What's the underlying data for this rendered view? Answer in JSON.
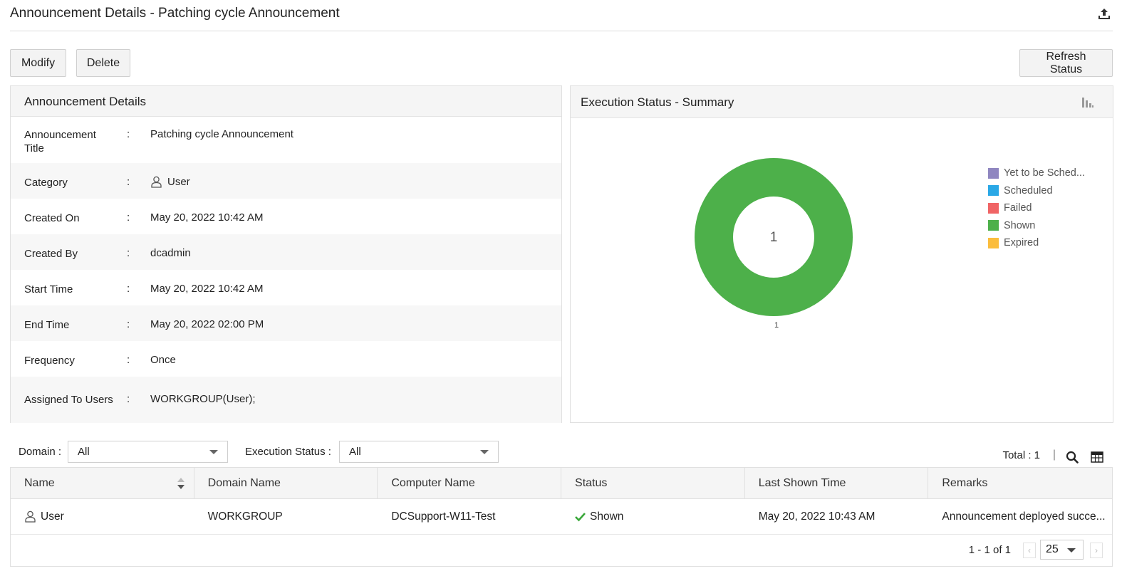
{
  "page": {
    "title": "Announcement Details - Patching cycle Announcement",
    "export_icon": "upload-export-icon"
  },
  "toolbar": {
    "modify_label": "Modify",
    "delete_label": "Delete",
    "refresh_label": "Refresh Status"
  },
  "details": {
    "header": "Announcement Details",
    "separator": ":",
    "rows": [
      {
        "label": "Announcement Title",
        "value": "Patching cycle Announcement"
      },
      {
        "label": "Category",
        "value": "User",
        "icon": "user-icon"
      },
      {
        "label": "Created On",
        "value": "May 20, 2022 10:42 AM"
      },
      {
        "label": "Created By",
        "value": "dcadmin"
      },
      {
        "label": "Start Time",
        "value": "May 20, 2022 10:42 AM"
      },
      {
        "label": "End Time",
        "value": "May 20, 2022 02:00 PM"
      },
      {
        "label": "Frequency",
        "value": "Once"
      },
      {
        "label": "Assigned To Users",
        "value": "WORKGROUP(User);"
      }
    ]
  },
  "summary": {
    "header": "Execution Status - Summary",
    "chart_toggle_icon": "bar-chart-icon",
    "chart_data": {
      "type": "pie",
      "categories": [
        "Yet to be Sched...",
        "Scheduled",
        "Failed",
        "Shown",
        "Expired"
      ],
      "values": [
        0,
        0,
        0,
        1,
        0
      ],
      "colors": [
        "#8f86c0",
        "#2aa8e6",
        "#f06465",
        "#4db04a",
        "#fbbd3c"
      ],
      "center_label": "1",
      "slice_label": "1",
      "legend_position": "right"
    }
  },
  "filters": {
    "domain_label": "Domain :",
    "domain_value": "All",
    "status_label": "Execution Status :",
    "status_value": "All",
    "total": "Total : 1",
    "separator": "|",
    "search_icon": "search-icon",
    "columns_icon": "table-columns-icon"
  },
  "table": {
    "headers": [
      "Name",
      "Domain Name",
      "Computer Name",
      "Status",
      "Last Shown Time",
      "Remarks"
    ],
    "rows": [
      {
        "name": "User",
        "domain": "WORKGROUP",
        "computer": "DCSupport-W11-Test",
        "status": "Shown",
        "last_shown": "May 20, 2022 10:43 AM",
        "remarks": "Announcement deployed succe..."
      }
    ],
    "pagination": {
      "range": "1 - 1 of 1",
      "page_size": "25",
      "prev": "‹",
      "next": "›"
    }
  }
}
